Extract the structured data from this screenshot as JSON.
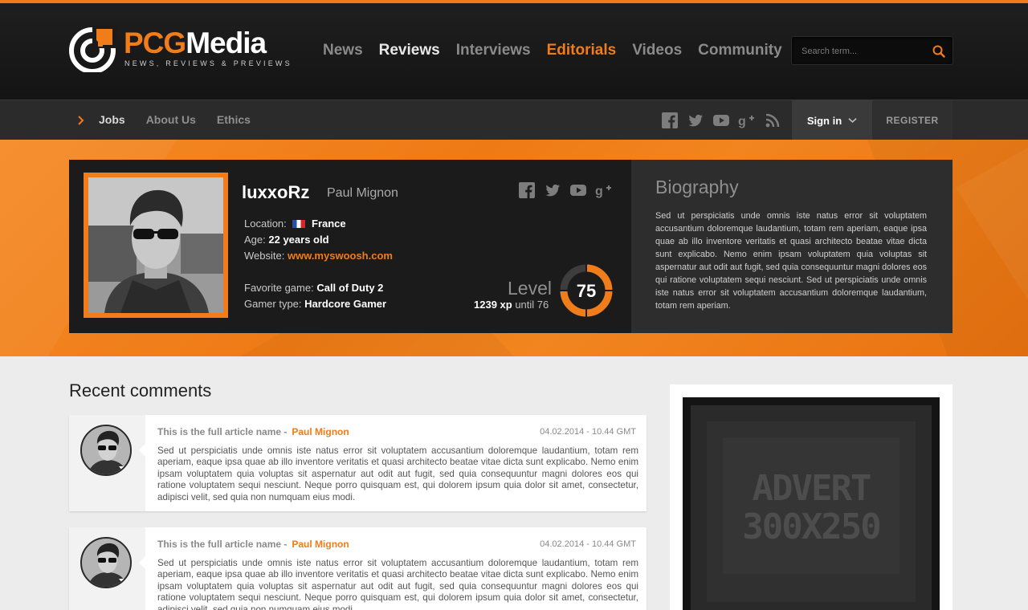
{
  "brand": {
    "name_part1": "PCG",
    "name_part2": "Media",
    "tagline": "NEWS, REVIEWS & PREVIEWS",
    "accent_color": "#f07c1a"
  },
  "main_nav": {
    "items": [
      {
        "label": "News"
      },
      {
        "label": "Reviews"
      },
      {
        "label": "Interviews"
      },
      {
        "label": "Editorials"
      },
      {
        "label": "Videos"
      },
      {
        "label": "Community"
      }
    ]
  },
  "search": {
    "placeholder": "Search term...",
    "icon": "search-icon"
  },
  "sub_nav": {
    "items": [
      {
        "label": "Jobs"
      },
      {
        "label": "About Us"
      },
      {
        "label": "Ethics"
      }
    ],
    "social_icons": [
      "facebook-icon",
      "twitter-icon",
      "youtube-icon",
      "google-plus-icon",
      "rss-icon"
    ],
    "sign_in_label": "Sign in",
    "register_label": "REGISTER"
  },
  "profile": {
    "username": "luxxoRz",
    "real_name": "Paul Mignon",
    "location_label": "Location:",
    "location_value": "France",
    "age_label": "Age:",
    "age_value": "22 years old",
    "website_label": "Website:",
    "website_value": "www.myswoosh.com",
    "favorite_game_label": "Favorite game:",
    "favorite_game_value": "Call of Duty 2",
    "gamer_type_label": "Gamer type:",
    "gamer_type_value": "Hardcore Gamer",
    "social_icons": [
      "facebook-icon",
      "twitter-icon",
      "youtube-icon",
      "google-plus-icon"
    ],
    "level_label": "Level",
    "level_value": "75",
    "xp_value": "1239 xp",
    "xp_suffix": "until 76",
    "level_progress_fraction": 0.75
  },
  "biography": {
    "title": "Biography",
    "text": "Sed ut perspiciatis unde omnis iste natus error sit voluptatem accusantium doloremque laudantium, totam rem aperiam, eaque ipsa quae ab illo inventore veritatis et quasi architecto beatae vitae dicta sunt explicabo. Nemo enim ipsam voluptatem quia voluptas sit aspernatur aut odit aut fugit, sed quia consequuntur magni dolores eos qui ratione voluptatem sequi nesciunt. Sed ut perspiciatis unde omnis iste natus error sit voluptatem accusantium doloremque laudantium, totam rem aperiam."
  },
  "recent_comments": {
    "title": "Recent comments",
    "items": [
      {
        "article": "This is the full article name -",
        "author": "Paul Mignon",
        "date": "04.02.2014 - 10.44 GMT",
        "text": "Sed ut perspiciatis unde omnis iste natus error sit voluptatem accusantium doloremque laudantium, totam rem aperiam, eaque ipsa quae ab illo inventore veritatis et quasi architecto beatae vitae dicta sunt explicabo. Nemo enim ipsam voluptatem quia voluptas sit aspernatur aut odit aut fugit, sed quia consequuntur magni dolores eos qui ratione voluptatem sequi nesciunt. Neque porro quisquam est, qui dolorem ipsum quia dolor sit amet, consectetur, adipisci velit, sed quia non numquam eius modi."
      },
      {
        "article": "This is the full article name -",
        "author": "Paul Mignon",
        "date": "04.02.2014 - 10.44 GMT",
        "text": "Sed ut perspiciatis unde omnis iste natus error sit voluptatem accusantium doloremque laudantium, totam rem aperiam, eaque ipsa quae ab illo inventore veritatis et quasi architecto beatae vitae dicta sunt explicabo. Nemo enim ipsam voluptatem quia voluptas sit aspernatur aut odit aut fugit, sed quia consequuntur magni dolores eos qui ratione voluptatem sequi nesciunt. Neque porro quisquam est, qui dolorem ipsum quia dolor sit amet, consectetur, adipisci velit, sed quia non numquam eius modi."
      }
    ]
  },
  "advert": {
    "line1": "ADVERT",
    "line2": "300X250"
  }
}
